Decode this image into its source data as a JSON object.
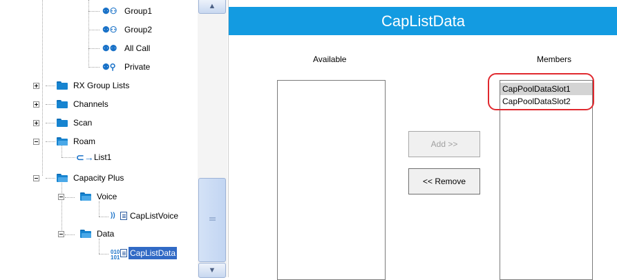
{
  "tree": {
    "items": [
      {
        "label": "Group1"
      },
      {
        "label": "Group2"
      },
      {
        "label": "All Call"
      },
      {
        "label": "Private"
      },
      {
        "label": "RX Group Lists"
      },
      {
        "label": "Channels"
      },
      {
        "label": "Scan"
      },
      {
        "label": "Roam"
      },
      {
        "label": "List1"
      },
      {
        "label": "Capacity Plus"
      },
      {
        "label": "Voice"
      },
      {
        "label": "CapListVoice"
      },
      {
        "label": "Data"
      },
      {
        "label": "CapListData"
      }
    ]
  },
  "scrollbar": {
    "up": "▲",
    "down": "▼"
  },
  "panel": {
    "title": "CapListData",
    "available_label": "Available",
    "members_label": "Members",
    "add_button": "Add >>",
    "remove_button": "<< Remove",
    "available_items": [],
    "members_items": [
      "CapPoolDataSlot1",
      "CapPoolDataSlot2"
    ]
  },
  "colors": {
    "header": "#139be1",
    "selection": "#316ac5",
    "highlight": "#e0282e"
  }
}
